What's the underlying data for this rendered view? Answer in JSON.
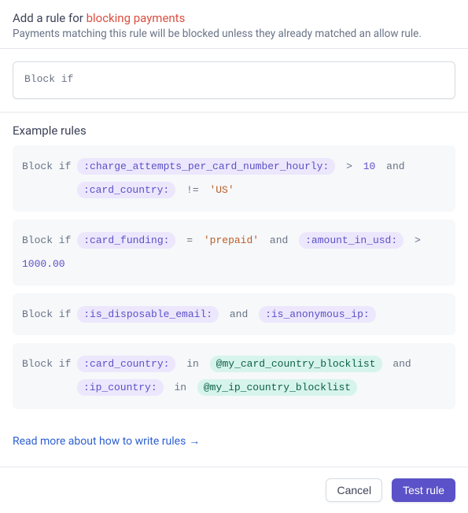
{
  "header": {
    "title_prefix": "Add a rule for ",
    "title_emphasis": "blocking payments",
    "subtitle": "Payments matching this rule will be blocked unless they already matched an allow rule."
  },
  "input": {
    "placeholder": "Block if"
  },
  "examples": {
    "title": "Example rules",
    "rows": [
      {
        "keyword": "Block if",
        "lines": [
          [
            {
              "type": "field",
              "text": ":charge_attempts_per_card_number_hourly:"
            },
            {
              "type": "op",
              "text": ">"
            },
            {
              "type": "number",
              "text": "10"
            },
            {
              "type": "op",
              "text": "and"
            }
          ],
          [
            {
              "type": "field",
              "text": ":card_country:"
            },
            {
              "type": "op",
              "text": "!="
            },
            {
              "type": "string",
              "text": "'US'"
            }
          ]
        ]
      },
      {
        "keyword": "Block if",
        "lines": [
          [
            {
              "type": "field",
              "text": ":card_funding:"
            },
            {
              "type": "op",
              "text": "="
            },
            {
              "type": "string",
              "text": "'prepaid'"
            },
            {
              "type": "op",
              "text": "and"
            },
            {
              "type": "field",
              "text": ":amount_in_usd:"
            },
            {
              "type": "op",
              "text": ">"
            },
            {
              "type": "number",
              "text": "1000.00"
            }
          ]
        ]
      },
      {
        "keyword": "Block if",
        "lines": [
          [
            {
              "type": "field",
              "text": ":is_disposable_email:"
            },
            {
              "type": "op",
              "text": "and"
            },
            {
              "type": "field",
              "text": ":is_anonymous_ip:"
            }
          ]
        ]
      },
      {
        "keyword": "Block if",
        "lines": [
          [
            {
              "type": "field",
              "text": ":card_country:"
            },
            {
              "type": "op",
              "text": "in"
            },
            {
              "type": "at",
              "text": "@my_card_country_blocklist"
            },
            {
              "type": "op",
              "text": "and"
            }
          ],
          [
            {
              "type": "field",
              "text": ":ip_country:"
            },
            {
              "type": "op",
              "text": "in"
            },
            {
              "type": "at",
              "text": "@my_ip_country_blocklist"
            }
          ]
        ]
      }
    ]
  },
  "link": {
    "text": "Read more about how to write rules",
    "arrow": "→"
  },
  "footer": {
    "cancel": "Cancel",
    "test": "Test rule"
  }
}
